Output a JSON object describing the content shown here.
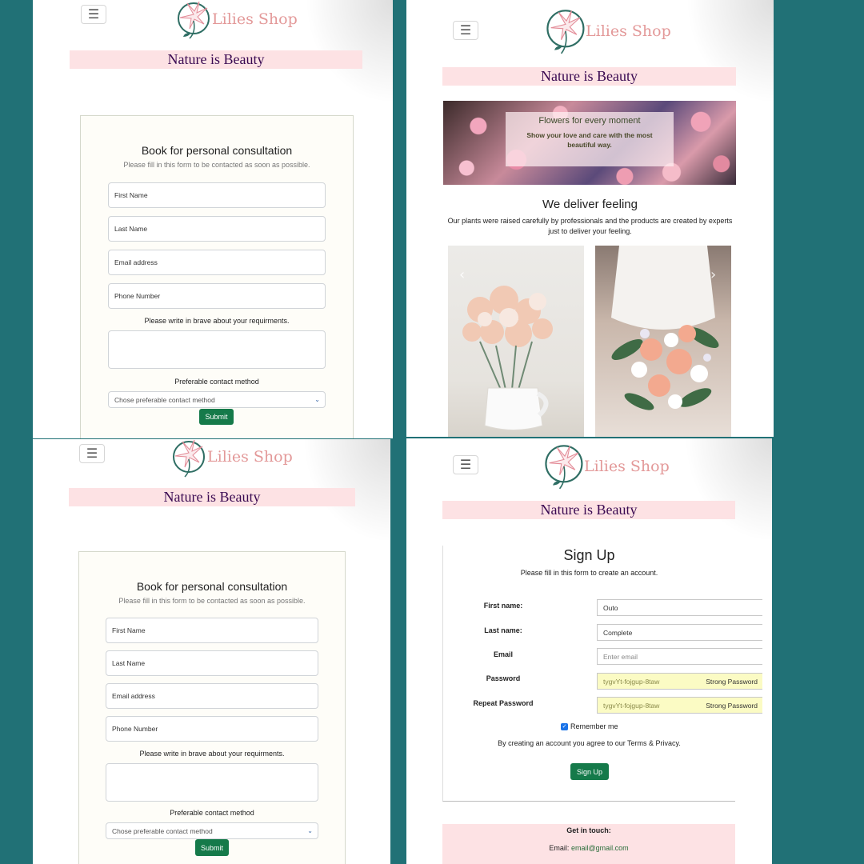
{
  "brand": {
    "name": "Lilies Shop",
    "tagline": "Nature is Beauty",
    "menu_icon": "☰"
  },
  "consultation": {
    "title": "Book for personal consultation",
    "subtitle": "Please fill in this form to be contacted as soon as possible.",
    "fields": {
      "first_name": "First Name",
      "last_name": "Last Name",
      "email": "Email address",
      "phone": "Phone Number"
    },
    "requirements_label": "Please write in brave about your requirments.",
    "contact_label": "Preferable contact method",
    "contact_select": "Chose preferable contact method",
    "submit": "Submit"
  },
  "shop": {
    "hero_title": "Flowers for every moment",
    "hero_text": "Show your love and care with the most beautiful way.",
    "section_title": "We deliver feeling",
    "section_text": "Our plants were raised carefully by professionals and the products are created by experts just to deliver your feeling.",
    "carousel_prev": "‹",
    "carousel_next": "›"
  },
  "signup": {
    "title": "Sign Up",
    "subtitle": "Please fill in this form to create an account.",
    "labels": {
      "first_name": "First name:",
      "last_name": "Last name:",
      "email": "Email",
      "password": "Password",
      "repeat": "Repeat Password"
    },
    "values": {
      "first_name": "Outo",
      "last_name": "Complete",
      "email_placeholder": "Enter email",
      "password": "tygvYt-fojgup-8taw",
      "repeat": "tygvYt-fojgup-8taw",
      "strength": "Strong Password"
    },
    "remember": "Remember me",
    "agree": "By creating an account you agree to our Terms & Privacy.",
    "button": "Sign Up"
  },
  "footer": {
    "heading": "Get in touch:",
    "email_label": "Email:",
    "email": "email@gmail.com"
  },
  "colors": {
    "background": "#217176",
    "tagline_bg": "#fde2e4",
    "brand_text": "#e39999",
    "button": "#157a4a"
  }
}
